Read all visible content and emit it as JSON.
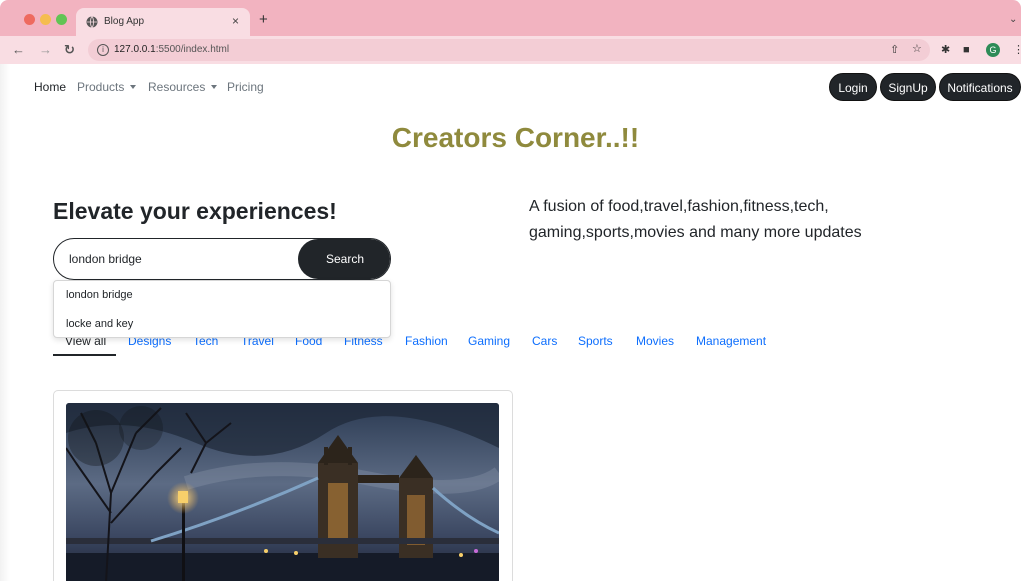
{
  "browser": {
    "tab_title": "Blog App",
    "tab_close": "×",
    "new_tab": "+",
    "url_host": "127.0.0.1",
    "url_rest": ":5500/index.html",
    "profile_initial": "G"
  },
  "navbar": {
    "links": [
      "Home",
      "Products",
      "Resources",
      "Pricing"
    ],
    "buttons": {
      "login": "Login",
      "signup": "SignUp",
      "notifications": "Notifications"
    }
  },
  "site_title": "Creators Corner..!!",
  "hero": {
    "heading": "Elevate your experiences!",
    "description": "A fusion of food,travel,fashion,fitness,tech, gaming,sports,movies and many more updates"
  },
  "search": {
    "value": "london bridge",
    "button_label": "Search",
    "suggestions": [
      "london bridge",
      "locke and key"
    ]
  },
  "categories": [
    "View all",
    "Designs",
    "Tech",
    "Travel",
    "Food",
    "Fitness",
    "Fashion",
    "Gaming",
    "Cars",
    "Sports",
    "Movies",
    "Management"
  ],
  "card": {
    "image": "london-tower-bridge-night-photo"
  },
  "colors": {
    "title": "#8f8a3d",
    "link": "#0d6efd",
    "dark": "#212529",
    "tabbar": "#f2b3c0"
  }
}
